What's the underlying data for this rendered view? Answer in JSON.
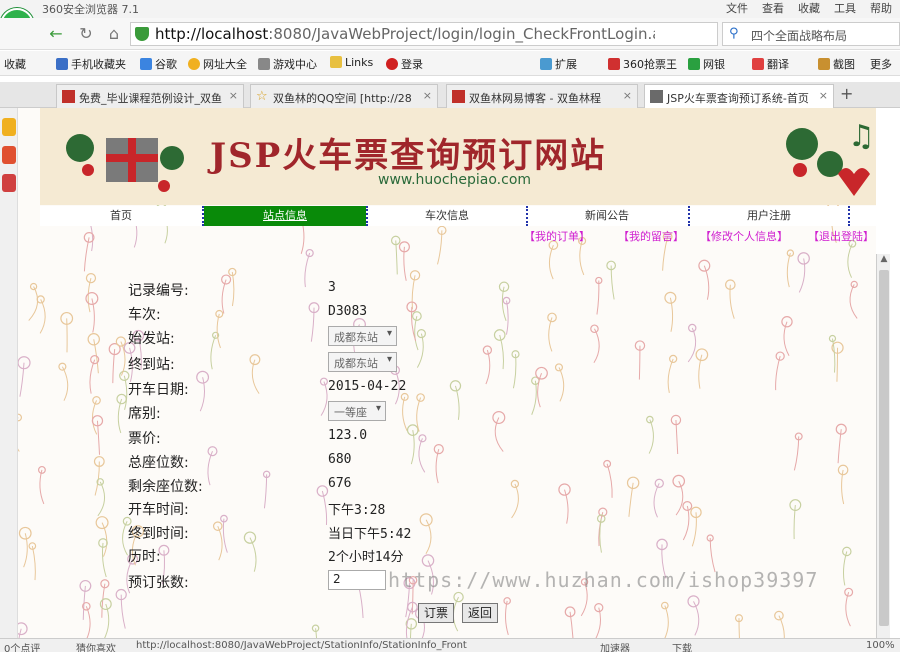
{
  "browser": {
    "app_title": "360安全浏览器 7.1",
    "logo_glyph": "e",
    "menu": [
      "文件",
      "查看",
      "收藏",
      "工具",
      "帮助"
    ],
    "url_host": "http://localhost",
    "url_rest": ":8080/JavaWebProject/login/login_CheckFrontLogin.actic",
    "search_placeholder": "四个全面战略布局",
    "bookmarks": [
      "收藏",
      "手机收藏夹",
      "谷歌",
      "网址大全",
      "游戏中心",
      "Links",
      "登录",
      "扩展",
      "360抢票王",
      "网银",
      "翻译",
      "截图",
      "更多"
    ],
    "tabs": [
      {
        "label": "免费_毕业课程范例设计_双鱼"
      },
      {
        "label": "双鱼林的QQ空间 [http://28"
      },
      {
        "label": "双鱼林网易博客 - 双鱼林程"
      },
      {
        "label": "JSP火车票查询预订系统-首页"
      }
    ],
    "status_left": "0个点评",
    "status_mid": "猜你喜欢",
    "status_url": "http://localhost:8080/JavaWebProject/StationInfo/StationInfo_Front",
    "status_speed": "加速器",
    "status_download": "下载",
    "status_zoom": "100%"
  },
  "site": {
    "title": "JSP火车票查询预订网站",
    "subtitle": "www.huochepiao.com",
    "nav": [
      "首页",
      "站点信息",
      "车次信息",
      "新闻公告",
      "用户注册"
    ],
    "subnav": [
      "【我的订单】",
      "【我的留言】",
      "【修改个人信息】",
      "【退出登陆】"
    ]
  },
  "detail": {
    "rows": [
      {
        "label": "记录编号:",
        "value": "3"
      },
      {
        "label": "车次:",
        "value": "D3083"
      },
      {
        "label": "始发站:",
        "value": "成都东站"
      },
      {
        "label": "终到站:",
        "value": "成都东站"
      },
      {
        "label": "开车日期:",
        "value": "2015-04-22"
      },
      {
        "label": "席别:",
        "value": "一等座"
      },
      {
        "label": "票价:",
        "value": "123.0"
      },
      {
        "label": "总座位数:",
        "value": "680"
      },
      {
        "label": "剩余座位数:",
        "value": "676"
      },
      {
        "label": "开车时间:",
        "value": "下午3:28"
      },
      {
        "label": "终到时间:",
        "value": "当日下午5:42"
      },
      {
        "label": "历时:",
        "value": "2个小时14分"
      },
      {
        "label": "预订张数:",
        "value": "2"
      }
    ],
    "book_button": "订票",
    "back_button": "返回"
  },
  "watermark": "https://www.huzhan.com/ishop39397",
  "colors": {
    "accent_green": "#098a09",
    "banner_red": "#a0262b",
    "link_magenta": "#d020d0"
  }
}
